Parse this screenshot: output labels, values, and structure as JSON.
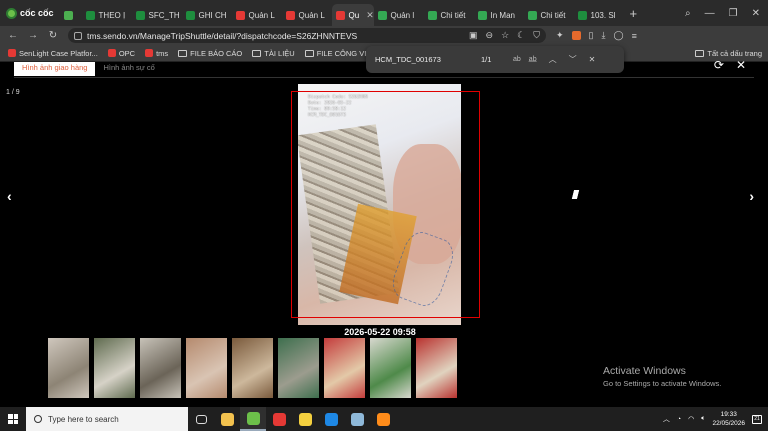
{
  "browser": {
    "brand": "cốc cốc",
    "tabs": [
      {
        "label": "",
        "color": "#4caf50"
      },
      {
        "label": "THEO Ị",
        "color": "#1e8e3e"
      },
      {
        "label": "SFC_TH",
        "color": "#1e8e3e"
      },
      {
        "label": "GHI CH",
        "color": "#1e8e3e"
      },
      {
        "label": "Quản L",
        "color": "#e53935"
      },
      {
        "label": "Quản L",
        "color": "#e53935"
      },
      {
        "label": "Qu",
        "color": "#e53935",
        "active": true
      },
      {
        "label": "Quản l",
        "color": "#34a853"
      },
      {
        "label": "Chi tiết",
        "color": "#34a853"
      },
      {
        "label": "In Man",
        "color": "#34a853"
      },
      {
        "label": "Chi tiết",
        "color": "#34a853"
      },
      {
        "label": "103. Sl",
        "color": "#1e8e3e"
      }
    ],
    "close_tab_glyph": "✕",
    "new_tab_glyph": "+",
    "window_controls": {
      "minimize": "—",
      "maximize": "❐",
      "close": "✕"
    },
    "url": "tms.sendo.vn/ManageTripShuttle/detail/?dispatchcode=S26ZHNNTEVS",
    "bookmarks": [
      {
        "label": "SenLight Case Platfor...",
        "icon": "sendo-icon"
      },
      {
        "label": "OPC",
        "icon": "sendo-icon"
      },
      {
        "label": "tms",
        "icon": "sendo-icon"
      },
      {
        "label": "FILE BÁO CÁO",
        "icon": "folder-icon"
      },
      {
        "label": "TÀI LIỆU",
        "icon": "folder-icon"
      },
      {
        "label": "FILE CÔNG VIỆC",
        "icon": "folder-icon"
      }
    ],
    "all_bookmarks": "Tất cả dấu trang"
  },
  "find": {
    "query": "HCM_TDC_001673",
    "count": "1/1",
    "match_case": "ab",
    "whole_word": "a̲b̲"
  },
  "viewer": {
    "tabs": [
      "Hình ảnh giao hàng",
      "Hình ảnh sự cố"
    ],
    "counter": "1 / 9",
    "prev": "‹",
    "next": "›",
    "timestamp": "2026-05-22 09:58",
    "stamp_lines": [
      "Dispatch Code: S26ZHNN",
      "Date: 2026-05-22",
      "Time: 09:58:12",
      "HCM_TDC_001673"
    ],
    "thumbnails": [
      {
        "color_a": "#cfc7bd",
        "color_b": "#8d8475"
      },
      {
        "color_a": "#5f6b4f",
        "color_b": "#d6d2c7"
      },
      {
        "color_a": "#c7c2b8",
        "color_b": "#6b6458"
      },
      {
        "color_a": "#b58a6e",
        "color_b": "#d9c4b3"
      },
      {
        "color_a": "#7a5a3c",
        "color_b": "#cdb89c"
      },
      {
        "color_a": "#3e6f4e",
        "color_b": "#9c9c8e"
      },
      {
        "color_a": "#c43c3c",
        "color_b": "#e3c9a8"
      },
      {
        "color_a": "#d8d8cf",
        "color_b": "#4f8a4a"
      },
      {
        "color_a": "#b9322f",
        "color_b": "#e0d3bf"
      }
    ]
  },
  "overlay": {
    "title": "Activate Windows",
    "subtitle": "Go to Settings to activate Windows."
  },
  "taskbar": {
    "search_placeholder": "Type here to search",
    "apps": [
      {
        "name": "task-view-icon",
        "color": "#444"
      },
      {
        "name": "file-explorer-icon",
        "color": "#f2c14e"
      },
      {
        "name": "coccoc-icon",
        "color": "#6cc04a",
        "active": true
      },
      {
        "name": "wps-icon",
        "color": "#e53935"
      },
      {
        "name": "sticky-notes-icon",
        "color": "#f4d03f"
      },
      {
        "name": "zalo-icon",
        "color": "#1e88e5"
      },
      {
        "name": "notepad-icon",
        "color": "#8fb9d9"
      },
      {
        "name": "sublime-icon",
        "color": "#ff8c1a"
      }
    ],
    "time": "19:33",
    "date": "22/05/2026",
    "notifications": "21"
  }
}
